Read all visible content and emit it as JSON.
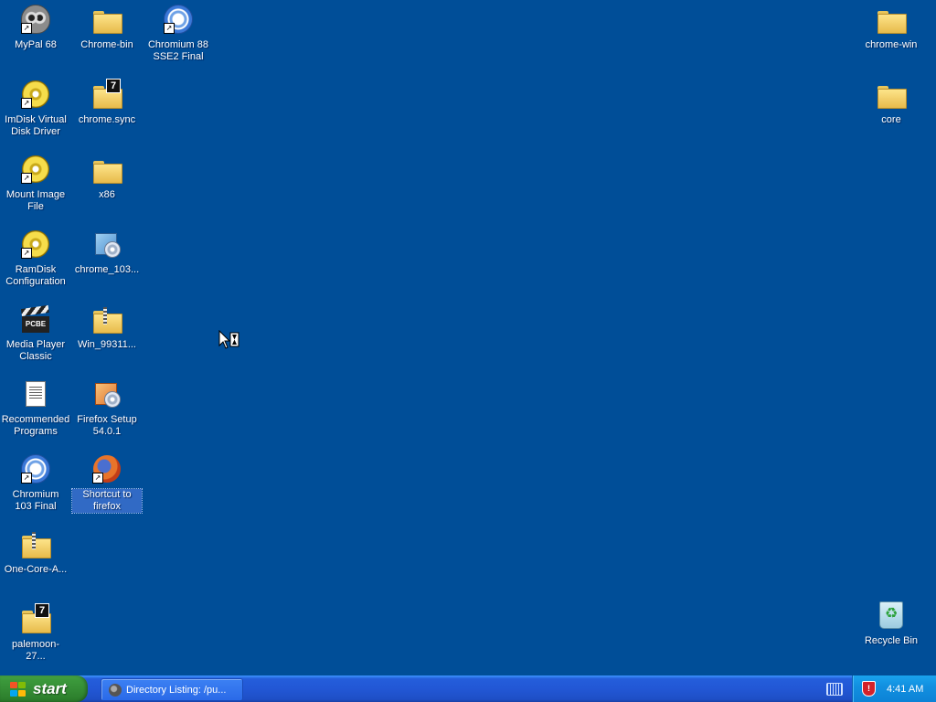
{
  "desktop": {
    "background": "#004e98",
    "icons": [
      {
        "label": "MyPal 68",
        "kind": "mypal-icon"
      },
      {
        "label": "Chrome-bin",
        "kind": "folder-icon"
      },
      {
        "label": "Chromium 88 SSE2 Final",
        "kind": "chromium-icon"
      },
      {
        "label": "chrome-win",
        "kind": "folder-icon"
      },
      {
        "label": "ImDisk Virtual Disk Driver",
        "kind": "disc-icon"
      },
      {
        "label": "chrome.sync",
        "kind": "7zip-folder-icon"
      },
      {
        "label": "core",
        "kind": "folder-icon"
      },
      {
        "label": "Mount Image File",
        "kind": "disc-icon"
      },
      {
        "label": "x86",
        "kind": "folder-icon"
      },
      {
        "label": "RamDisk Configuration",
        "kind": "disc-icon"
      },
      {
        "label": "chrome_103...",
        "kind": "installer-icon"
      },
      {
        "label": "Media Player Classic",
        "kind": "clapperboard-icon"
      },
      {
        "label": "Win_99311...",
        "kind": "zip-folder-icon"
      },
      {
        "label": "Recommended Programs",
        "kind": "document-icon"
      },
      {
        "label": "Firefox Setup 54.0.1",
        "kind": "installer-icon"
      },
      {
        "label": "Chromium 103 Final",
        "kind": "chromium-icon"
      },
      {
        "label": "Shortcut to firefox",
        "kind": "firefox-icon"
      },
      {
        "label": "One-Core-A...",
        "kind": "zip-folder-icon"
      },
      {
        "label": "palemoon-27...",
        "kind": "7zip-folder-icon"
      },
      {
        "label": "Recycle Bin",
        "kind": "recycle-bin-icon"
      }
    ]
  },
  "taskbar": {
    "start_label": "start",
    "task_item_label": "Directory Listing: /pu...",
    "clock": "4:41 AM",
    "clapper_text": "PCBE",
    "badge_seven": "7",
    "shortcut_arrow": "↗"
  }
}
